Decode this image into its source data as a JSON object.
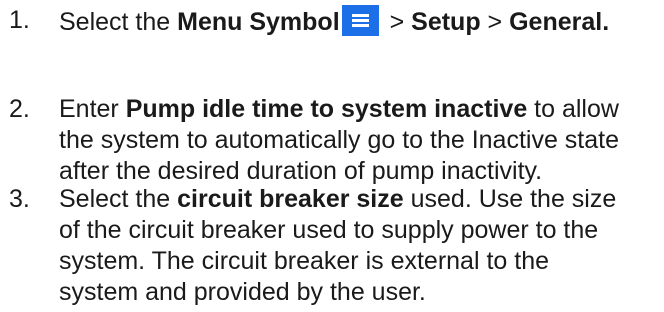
{
  "steps": [
    {
      "number": "1.",
      "parts": {
        "a": "Select the ",
        "b": "Menu Symbol",
        "c": " > ",
        "d": "Setup",
        "e": " > ",
        "f": "General."
      }
    },
    {
      "number": "2.",
      "lines": {
        "l1a": "Enter ",
        "l1b": "Pump idle time to system inactive",
        "l1c": " to allow",
        "l2": "the system to automatically go to the Inactive state",
        "l3": "after the desired duration of pump inactivity."
      }
    },
    {
      "number": "3.",
      "lines": {
        "l1a": "Select the ",
        "l1b": "circuit breaker size",
        "l1c": " used. Use the size",
        "l2": "of the circuit breaker used to supply power to the",
        "l3": "system. The circuit breaker is external to the",
        "l4": "system and provided by the user."
      }
    }
  ],
  "icons": {
    "menu_symbol": "hamburger-menu-icon",
    "menu_symbol_color": "#1d6fe8"
  }
}
